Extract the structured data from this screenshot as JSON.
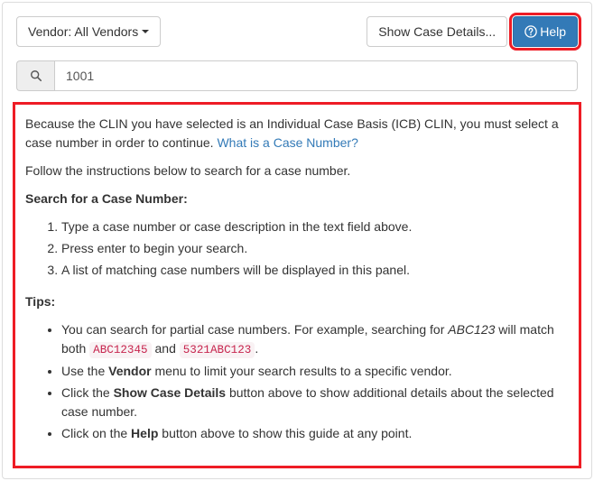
{
  "toolbar": {
    "vendor_label": "Vendor: All Vendors",
    "show_details_label": "Show Case Details...",
    "help_label": "Help"
  },
  "search": {
    "value": "1001"
  },
  "help": {
    "intro_prefix": "Because the CLIN you have selected is an Individual Case Basis (ICB) CLIN, you must select a case number in order to continue. ",
    "intro_link": "What is a Case Number?",
    "follow": "Follow the instructions below to search for a case number.",
    "search_heading": "Search for a Case Number:",
    "steps": [
      "Type a case number or case description in the text field above.",
      "Press enter to begin your search.",
      "A list of matching case numbers will be displayed in this panel."
    ],
    "tips_heading": "Tips:",
    "tip1_a": "You can search for partial case numbers. For example, searching for ",
    "tip1_term": "ABC123",
    "tip1_b": " will match both ",
    "tip1_code1": "ABC12345",
    "tip1_c": " and ",
    "tip1_code2": "5321ABC123",
    "tip1_d": ".",
    "tip2_a": "Use the ",
    "tip2_strong": "Vendor",
    "tip2_b": " menu to limit your search results to a specific vendor.",
    "tip3_a": "Click the ",
    "tip3_strong": "Show Case Details",
    "tip3_b": " button above to show additional details about the selected case number.",
    "tip4_a": "Click on the ",
    "tip4_strong": "Help",
    "tip4_b": " button above to show this guide at any point."
  }
}
